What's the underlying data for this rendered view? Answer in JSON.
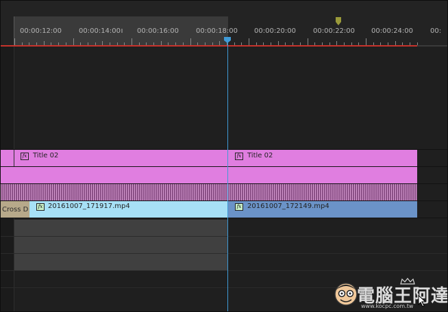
{
  "ruler": {
    "timecodes": [
      "00:00:12:00",
      "00:00:14:00",
      "00:00:16:00",
      "00:00:18:00",
      "00:00:20:00",
      "00:00:22:00",
      "00:00:24:00",
      "00:"
    ]
  },
  "tracks": {
    "title_clips": [
      {
        "label": "Title 02",
        "fx": "fx"
      },
      {
        "label": "Title 02",
        "fx": "fx"
      }
    ],
    "transition_label": "Cross D",
    "video_clips": [
      {
        "label": "20161007_171917.mp4",
        "fx": "fx"
      },
      {
        "label": "20161007_172149.mp4",
        "fx": "fx"
      }
    ]
  },
  "colors": {
    "title_clip": "#e07ee0",
    "audio_band": "#c87bbf",
    "video_clip_light": "#a7e0f6",
    "video_clip_selected": "#6b93c8",
    "transition": "#b7a98a",
    "playhead": "#3f9ad6",
    "work_area_bar": "#c8332c"
  },
  "watermark": {
    "text": "電腦王阿達",
    "url": "www.kocpc.com.tw"
  }
}
